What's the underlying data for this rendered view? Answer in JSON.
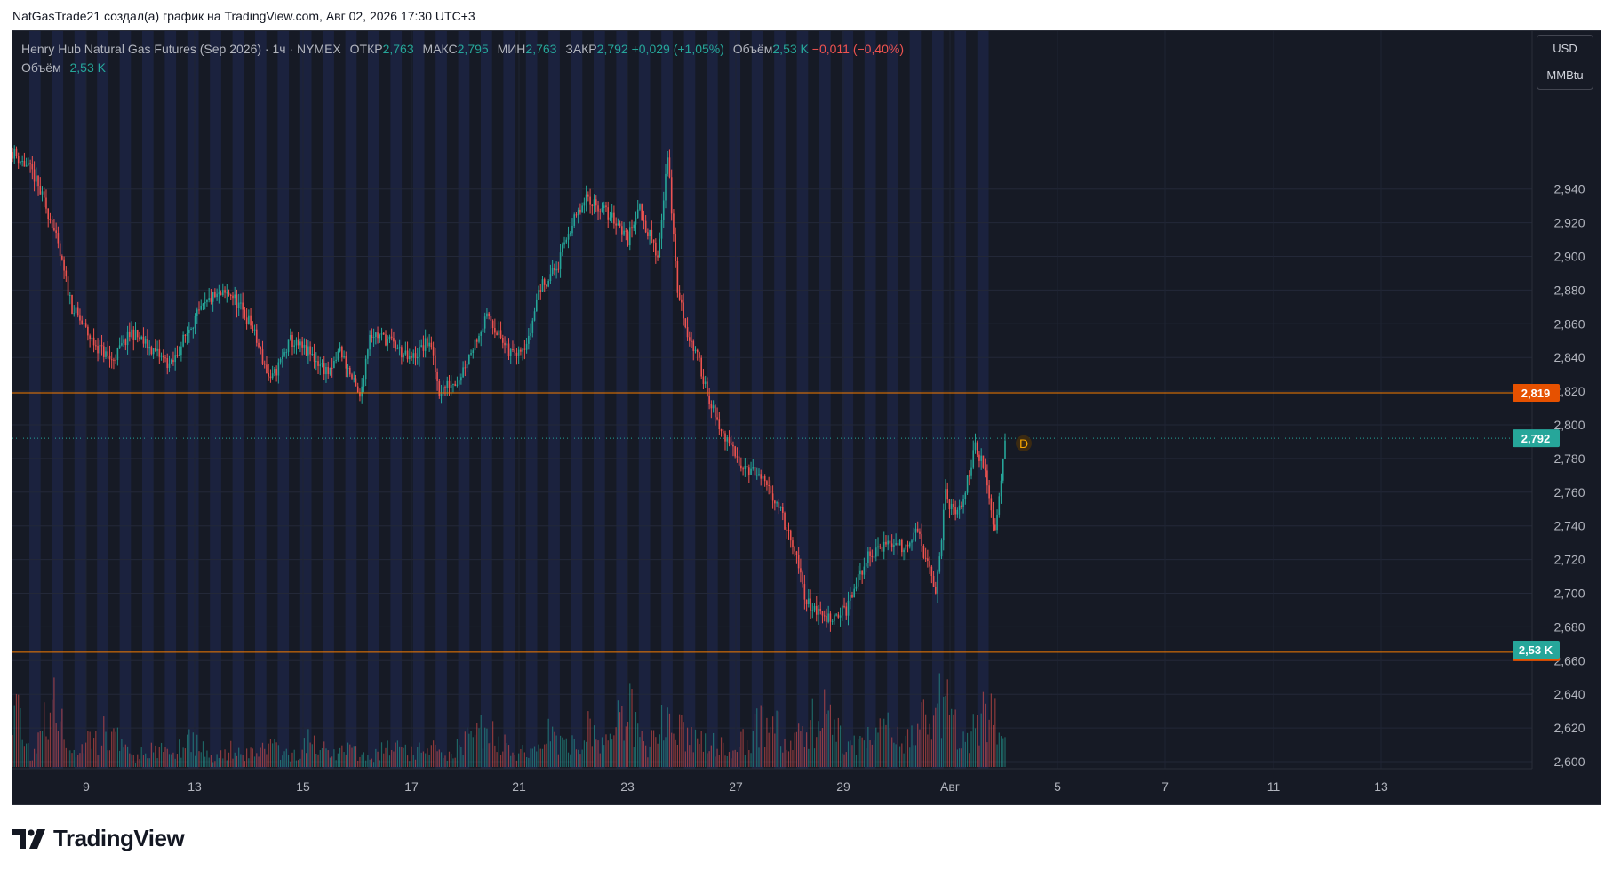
{
  "attribution": "NatGasTrade21 создал(а) график на TradingView.com, Авг 02, 2026 17:30 UTC+3",
  "brand": {
    "name": "TradingView",
    "icon": "tradingview-logo-icon"
  },
  "legend": {
    "symbol": "Henry Hub Natural Gas Futures (Sep 2026) · 1ч · NYMEX",
    "open_label": "ОТКР",
    "open": "2,763",
    "high_label": "МАКС",
    "high": "2,795",
    "low_label": "МИН",
    "low": "2,763",
    "close_label": "ЗАКР",
    "close": "2,792",
    "change": "+0,029 (+1,05%)",
    "volume_label": "Объём",
    "volume": "2,53 K",
    "volume_change": "−0,011 (−0,40%)",
    "volume_row_label": "Объём",
    "volume_row_value": "2,53 K"
  },
  "units": {
    "currency": "USD",
    "unit": "MMBtu"
  },
  "colors": {
    "up": "#26a69a",
    "down": "#ef5350",
    "background": "#161a25",
    "session_band": "#1c2443",
    "level_line": "#f57c00"
  },
  "chart_data": {
    "type": "candlestick",
    "title": "Henry Hub Natural Gas Futures (Sep 2026)",
    "timeframe": "1ч",
    "y_ticks": [
      "2,600",
      "2,620",
      "2,640",
      "2,660",
      "2,680",
      "2,700",
      "2,720",
      "2,740",
      "2,760",
      "2,780",
      "2,800",
      "2,820",
      "2,840",
      "2,860",
      "2,880",
      "2,900",
      "2,920",
      "2,940"
    ],
    "ylim": [
      2.6,
      2.955
    ],
    "x_ticks": [
      "9",
      "13",
      "15",
      "17",
      "21",
      "23",
      "27",
      "29",
      "Авг",
      "5",
      "7",
      "11",
      "13"
    ],
    "horizontal_levels": [
      {
        "value": 2.819,
        "label": "2,819"
      },
      {
        "value": 2.665,
        "label": "2,665"
      }
    ],
    "last_price": {
      "value": 2.792,
      "label": "2,792"
    },
    "last_volume_label": "2,53 K",
    "event_marker": "D",
    "close_path": [
      [
        0,
        2.962
      ],
      [
        10,
        2.95
      ],
      [
        20,
        2.92
      ],
      [
        30,
        2.87
      ],
      [
        40,
        2.85
      ],
      [
        50,
        2.838
      ],
      [
        60,
        2.855
      ],
      [
        70,
        2.845
      ],
      [
        80,
        2.835
      ],
      [
        90,
        2.86
      ],
      [
        100,
        2.875
      ],
      [
        110,
        2.878
      ],
      [
        120,
        2.86
      ],
      [
        130,
        2.825
      ],
      [
        140,
        2.85
      ],
      [
        150,
        2.842
      ],
      [
        160,
        2.83
      ],
      [
        165,
        2.845
      ],
      [
        175,
        2.815
      ],
      [
        180,
        2.855
      ],
      [
        190,
        2.85
      ],
      [
        200,
        2.838
      ],
      [
        210,
        2.85
      ],
      [
        215,
        2.82
      ],
      [
        225,
        2.828
      ],
      [
        235,
        2.855
      ],
      [
        240,
        2.865
      ],
      [
        250,
        2.842
      ],
      [
        260,
        2.85
      ],
      [
        265,
        2.88
      ],
      [
        275,
        2.895
      ],
      [
        280,
        2.915
      ],
      [
        290,
        2.935
      ],
      [
        295,
        2.93
      ],
      [
        305,
        2.92
      ],
      [
        310,
        2.91
      ],
      [
        315,
        2.93
      ],
      [
        325,
        2.9
      ],
      [
        330,
        2.96
      ],
      [
        335,
        2.88
      ],
      [
        340,
        2.855
      ],
      [
        345,
        2.84
      ],
      [
        350,
        2.82
      ],
      [
        355,
        2.8
      ],
      [
        365,
        2.78
      ],
      [
        375,
        2.77
      ],
      [
        385,
        2.755
      ],
      [
        395,
        2.72
      ],
      [
        400,
        2.695
      ],
      [
        410,
        2.685
      ],
      [
        420,
        2.69
      ],
      [
        430,
        2.72
      ],
      [
        440,
        2.73
      ],
      [
        450,
        2.728
      ],
      [
        455,
        2.74
      ],
      [
        460,
        2.72
      ],
      [
        465,
        2.7
      ],
      [
        470,
        2.758
      ],
      [
        475,
        2.745
      ],
      [
        480,
        2.76
      ],
      [
        485,
        2.79
      ],
      [
        490,
        2.77
      ],
      [
        495,
        2.738
      ],
      [
        500,
        2.792
      ]
    ],
    "volume_path": [
      [
        0,
        160
      ],
      [
        10,
        20
      ],
      [
        20,
        140
      ],
      [
        30,
        30
      ],
      [
        40,
        60
      ],
      [
        50,
        80
      ],
      [
        60,
        20
      ],
      [
        70,
        40
      ],
      [
        80,
        30
      ],
      [
        90,
        70
      ],
      [
        100,
        20
      ],
      [
        110,
        40
      ],
      [
        120,
        30
      ],
      [
        130,
        50
      ],
      [
        140,
        20
      ],
      [
        150,
        60
      ],
      [
        160,
        30
      ],
      [
        170,
        40
      ],
      [
        180,
        20
      ],
      [
        190,
        50
      ],
      [
        200,
        30
      ],
      [
        210,
        40
      ],
      [
        220,
        30
      ],
      [
        230,
        60
      ],
      [
        240,
        90
      ],
      [
        250,
        40
      ],
      [
        260,
        30
      ],
      [
        270,
        70
      ],
      [
        280,
        40
      ],
      [
        290,
        80
      ],
      [
        300,
        60
      ],
      [
        305,
        100
      ],
      [
        310,
        130
      ],
      [
        320,
        40
      ],
      [
        330,
        110
      ],
      [
        340,
        80
      ],
      [
        350,
        60
      ],
      [
        360,
        40
      ],
      [
        370,
        70
      ],
      [
        380,
        110
      ],
      [
        390,
        60
      ],
      [
        400,
        90
      ],
      [
        410,
        120
      ],
      [
        420,
        40
      ],
      [
        430,
        60
      ],
      [
        440,
        90
      ],
      [
        450,
        60
      ],
      [
        460,
        100
      ],
      [
        470,
        150
      ],
      [
        480,
        40
      ],
      [
        490,
        130
      ],
      [
        500,
        70
      ]
    ],
    "volume_ylim": [
      0,
      250
    ]
  }
}
